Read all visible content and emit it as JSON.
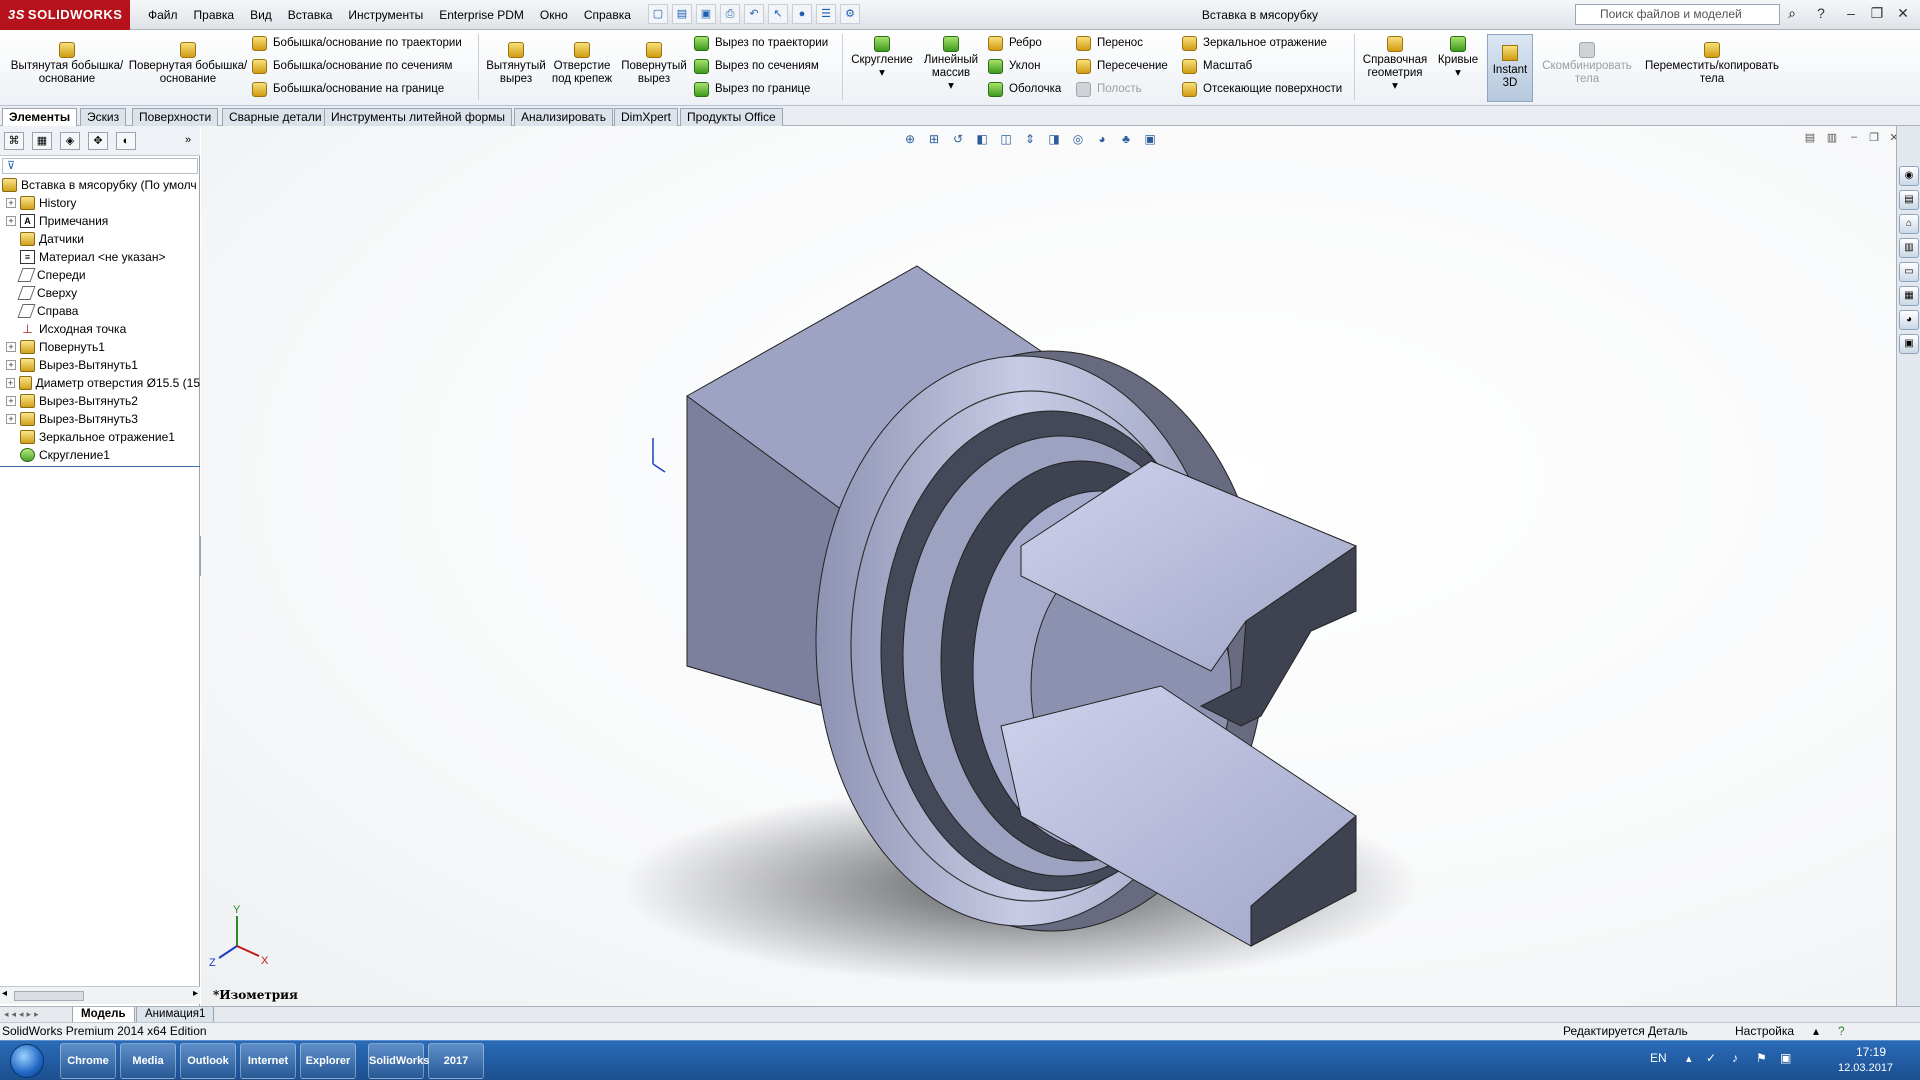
{
  "app": {
    "logo_text": "SOLIDWORKS",
    "logo_prefix": "3S",
    "menu": [
      "Файл",
      "Правка",
      "Вид",
      "Вставка",
      "Инструменты",
      "Enterprise PDM",
      "Окно",
      "Справка"
    ],
    "doc_title": "Вставка в мясорубку",
    "search_placeholder": "Поиск файлов и моделей"
  },
  "ribbon": {
    "extruded_boss": "Вытянутая бобышка/основание",
    "revolved_boss": "Повернутая бобышка/основание",
    "swept_boss": "Бобышка/основание по траектории",
    "lofted_boss": "Бобышка/основание по сечениям",
    "boundary_boss": "Бобышка/основание на границе",
    "extruded_cut": "Вытянутый вырез",
    "hole_wizard": "Отверстие под крепеж",
    "revolved_cut": "Повернутый вырез",
    "swept_cut": "Вырез по траектории",
    "lofted_cut": "Вырез по сечениям",
    "boundary_cut": "Вырез по границе",
    "fillet": "Скругление",
    "linear_pattern": "Линейный массив",
    "rib": "Ребро",
    "draft": "Уклон",
    "shell": "Оболочка",
    "wrap": "Перенос",
    "intersect": "Пересечение",
    "dome": "Полость",
    "mirror": "Зеркальное отражение",
    "scale": "Масштаб",
    "cut_surfaces": "Отсекающие поверхности",
    "ref_geometry": "Справочная геометрия",
    "curves": "Кривые",
    "instant3d": "Instant 3D",
    "combine": "Скомбинировать тела",
    "move_copy": "Переместить/копировать тела"
  },
  "tabs": [
    "Элементы",
    "Эскиз",
    "Поверхности",
    "Сварные детали",
    "Инструменты литейной формы",
    "Анализировать",
    "DimXpert",
    "Продукты Office"
  ],
  "tree": {
    "root": "Вставка в мясорубку  (По умолч",
    "items": [
      {
        "label": "History",
        "icon": "history-icon",
        "expandable": true
      },
      {
        "label": "Примечания",
        "icon": "annotations-icon",
        "expandable": true
      },
      {
        "label": "Датчики",
        "icon": "sensors-icon",
        "expandable": false
      },
      {
        "label": "Материал <не указан>",
        "icon": "material-icon",
        "expandable": false
      },
      {
        "label": "Спереди",
        "icon": "plane-icon",
        "expandable": false
      },
      {
        "label": "Сверху",
        "icon": "plane-icon",
        "expandable": false
      },
      {
        "label": "Справа",
        "icon": "plane-icon",
        "expandable": false
      },
      {
        "label": "Исходная точка",
        "icon": "origin-icon",
        "expandable": false
      },
      {
        "label": "Повернуть1",
        "icon": "revolve-icon",
        "expandable": true
      },
      {
        "label": "Вырез-Вытянуть1",
        "icon": "cut-extrude-icon",
        "expandable": true
      },
      {
        "label": "Диаметр отверстия Ø15.5 (15",
        "icon": "hole-icon",
        "expandable": true
      },
      {
        "label": "Вырез-Вытянуть2",
        "icon": "cut-extrude-icon",
        "expandable": true
      },
      {
        "label": "Вырез-Вытянуть3",
        "icon": "cut-extrude-icon",
        "expandable": true
      },
      {
        "label": "Зеркальное отражение1",
        "icon": "mirror-icon",
        "expandable": false
      },
      {
        "label": "Скругление1",
        "icon": "fillet-icon",
        "expandable": false
      }
    ]
  },
  "viewport": {
    "view_name": "*Изометрия",
    "triad": {
      "x": "X",
      "y": "Y",
      "z": "Z"
    }
  },
  "bottom_tabs": [
    "Модель",
    "Анимация1"
  ],
  "status": {
    "edition": "SolidWorks Premium 2014 x64 Edition",
    "editing": "Редактируется Деталь",
    "units": "Настройка"
  },
  "taskbar": {
    "apps": [
      "Chrome",
      "Media Player",
      "Outlook",
      "Internet Explorer",
      "Explorer",
      "SolidWorks",
      "2017"
    ],
    "lang": "EN",
    "time": "17:19",
    "date": "12.03.2017"
  },
  "colors": {
    "brand": "#b5121b",
    "part_body": "#a9adc8",
    "part_shadow": "#4a4c58"
  }
}
